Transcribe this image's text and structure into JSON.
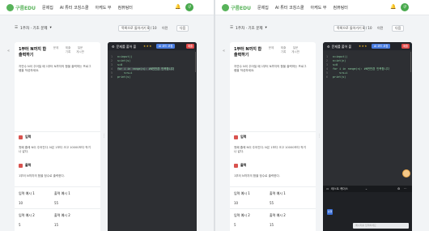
{
  "windows": [
    {
      "id": "winL",
      "nav": {
        "logo": "구름EDU",
        "links": [
          "문제집",
          "AI 튜터 코칭스쿨",
          "아케도 부",
          "컴퓨팅터"
        ],
        "avatar": "구"
      },
      "toolbar": {
        "course": "1주차 · 기초 문제",
        "progress_pill": "목록으로 돌아가기",
        "count": "8 / 10",
        "prev": "이전",
        "next": "다음"
      },
      "problem": {
        "title": "1부터 N까지 합 출력하기",
        "tabs": [
          "문제",
          "제출 기록",
          "질문 게시판"
        ],
        "desc": "자연수 N이 주어질 때 1부터 N까지의 합을 출력하는 프로그램을 작성하세요.",
        "input_head": "입력",
        "input_body": "첫째 줄에 N이 주어진다. N은 1보다 크고 10000보다 작거나 같다.",
        "output_head": "출력",
        "output_body": "1부터 N까지의 합을 정수로 출력한다.",
        "examples": [
          {
            "in_label": "입력 예시 1",
            "out_label": "출력 예시 1",
            "in_value": "10",
            "out_value": "55"
          },
          {
            "in_label": "입력 예시 2",
            "out_label": "출력 예시 2",
            "in_value": "5",
            "out_value": "15"
          }
        ]
      },
      "editor": {
        "title": "문제를 풀어 볼",
        "ai_button": "AI 코드 코칭",
        "submit": "제출"
      },
      "code_lines": [
        "n=input()",
        "s=int(s)",
        "s=0",
        "for i in range(n): #N번만큼 반복합니다",
        "    s=s+i",
        "print(s)"
      ]
    },
    {
      "id": "winR",
      "nav": {
        "logo": "구름EDU",
        "links": [
          "문제집",
          "AI 튜터 코칭스쿨",
          "아케도 부",
          "컴퓨팅터"
        ],
        "avatar": "구"
      },
      "toolbar": {
        "course": "1주차 · 기초 문제",
        "progress_pill": "목록으로 돌아가기",
        "count": "8 / 10",
        "prev": "이전",
        "next": "다음"
      },
      "problem": {
        "title": "1부터 N까지 합 출력하기",
        "tabs": [
          "문제",
          "제출 기록",
          "질문 게시판"
        ],
        "desc": "자연수 N이 주어질 때 1부터 N까지의 합을 출력하는 프로그램을 작성하세요.",
        "input_head": "입력",
        "input_body": "첫째 줄에 N이 주어진다. N은 1보다 크고 10000보다 작거나 같다.",
        "output_head": "출력",
        "output_body": "1부터 N까지의 합을 정수로 출력한다.",
        "examples": [
          {
            "in_label": "입력 예시 1",
            "out_label": "출력 예시 1",
            "in_value": "10",
            "out_value": "55"
          },
          {
            "in_label": "입력 예시 2",
            "out_label": "출력 예시 2",
            "in_value": "5",
            "out_value": "15"
          }
        ]
      },
      "editor": {
        "title": "문제를 풀어 볼",
        "ai_button": "AI 코드 코칭",
        "submit": "제출"
      },
      "code_lines": [
        "n=input()",
        "n=int(n)",
        "s=0",
        "for i in range(n): #N번만큼 반복합니다",
        "    s=s+i",
        "print(s)"
      ],
      "console": {
        "title": "테스트 케이스",
        "run": "실행",
        "input_placeholder": "메시지를 입력하세요"
      }
    }
  ]
}
